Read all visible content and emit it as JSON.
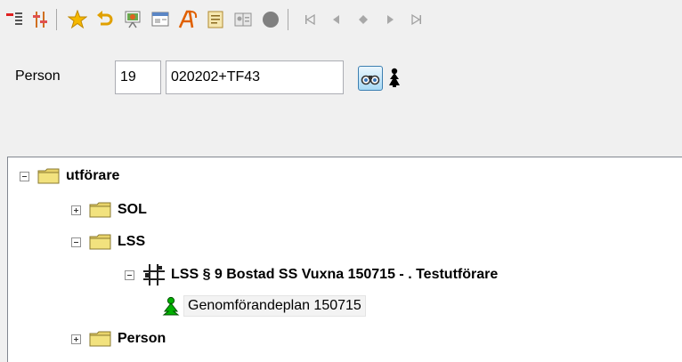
{
  "toolbar": {
    "items": [
      {
        "icon": "collapse-list-icon"
      },
      {
        "icon": "sliders-icon"
      },
      {
        "icon": "star-icon"
      },
      {
        "icon": "undo-icon"
      },
      {
        "icon": "presentation-icon"
      },
      {
        "icon": "window-icon"
      },
      {
        "icon": "font-icon"
      },
      {
        "icon": "document-icon"
      },
      {
        "icon": "id-card-icon"
      },
      {
        "icon": "record-stop-icon"
      },
      {
        "icon": "nav-first-icon"
      },
      {
        "icon": "nav-previous-icon"
      },
      {
        "icon": "nav-diamond-icon"
      },
      {
        "icon": "nav-next-icon"
      },
      {
        "icon": "nav-last-icon"
      }
    ]
  },
  "person": {
    "label": "Person",
    "number": "19",
    "id": "020202+TF43"
  },
  "tree": {
    "root": {
      "label": "utförare",
      "expanded": true
    },
    "sol": {
      "label": "SOL",
      "expanded": false
    },
    "lss": {
      "label": "LSS",
      "expanded": true
    },
    "lss_case": {
      "label": "LSS  § 9 Bostad SS Vuxna 150715 - . Testutförare",
      "expanded": true
    },
    "plan": {
      "label": "Genomförandeplan 150715"
    },
    "person": {
      "label": "Person",
      "expanded": false
    }
  },
  "colors": {
    "folder": "#e8d36a",
    "star": "#f5b800",
    "record": "#808080",
    "person_green": "#00b000"
  }
}
